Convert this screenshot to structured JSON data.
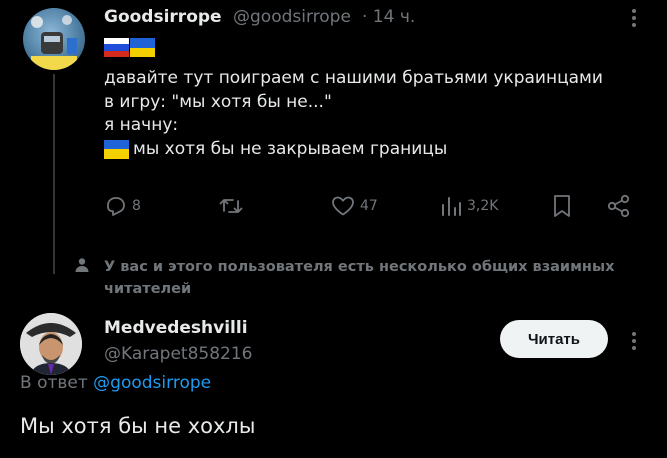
{
  "tweet": {
    "author_name": "Goodsirrope",
    "author_handle": "@goodsirrope",
    "time": "· 14 ч.",
    "text_lines": [
      "давайте тут поиграем с нашими братьями украинцами",
      "в игру: \"мы хотя бы не...\"",
      "я начну:",
      "мы хотя бы не закрываем границы"
    ],
    "actions": {
      "replies": "8",
      "reposts": "",
      "likes": "47",
      "views": "3,2K"
    }
  },
  "mutual_notice": {
    "line1": "У вас и этого пользователя есть несколько общих взаимных",
    "line2": "читателей"
  },
  "reply": {
    "author_name": "Medvedeshvilli",
    "author_handle": "@Karapet858216",
    "follow_label": "Читать",
    "in_reply_prefix": "В ответ",
    "in_reply_handle": "@goodsirrope",
    "text": "Мы хотя бы не хохлы"
  },
  "colors": {
    "background": "#000000",
    "text": "#e7e9ea",
    "muted": "#71767b",
    "link": "#1d9bf0",
    "follow_bg": "#eff3f4"
  },
  "icons": [
    "more-icon",
    "reply-icon",
    "repost-icon",
    "like-icon",
    "views-icon",
    "bookmark-icon",
    "share-icon",
    "people-icon"
  ]
}
